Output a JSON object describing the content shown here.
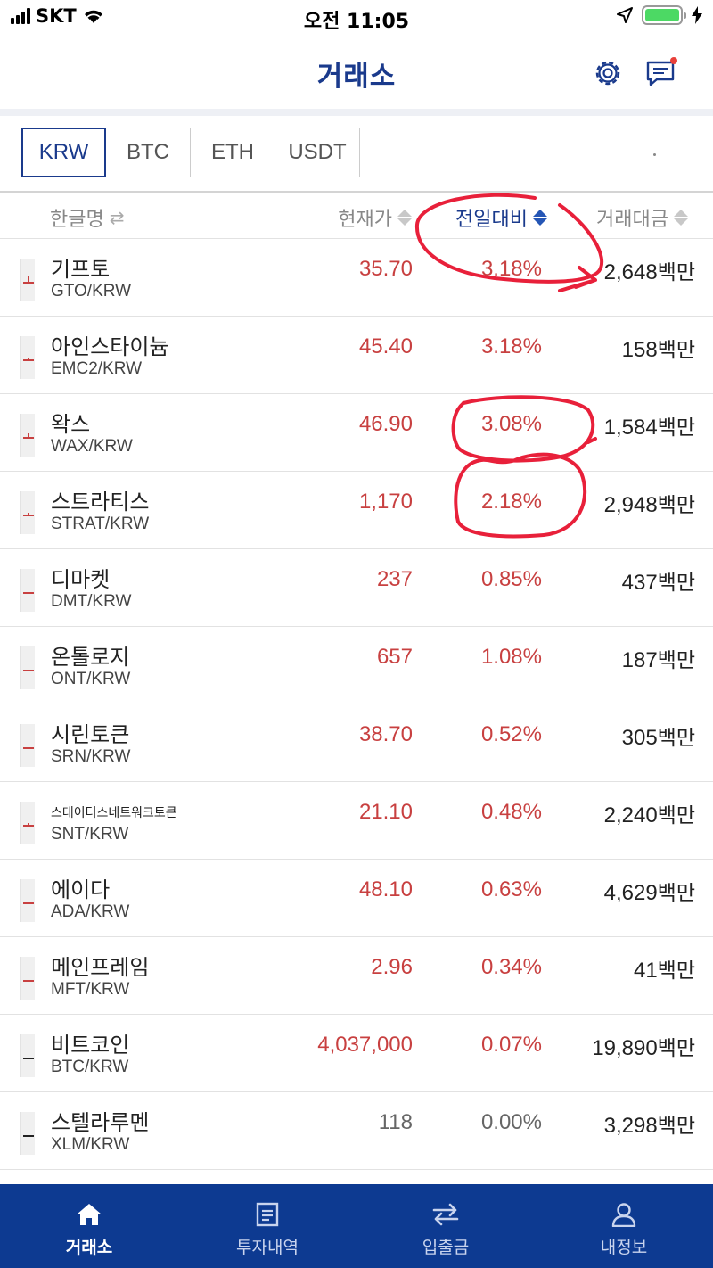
{
  "status_bar": {
    "carrier": "SKT",
    "time": "오전 11:05"
  },
  "header": {
    "title": "거래소"
  },
  "market_tabs": [
    "KRW",
    "BTC",
    "ETH",
    "USDT"
  ],
  "columns": {
    "name": "한글명",
    "price": "현재가",
    "change": "전일대비",
    "volume": "거래대금"
  },
  "coins": [
    {
      "name": "기프토",
      "pair": "GTO/KRW",
      "price": "35.70",
      "change": "3.18%",
      "volume_num": "2,648",
      "volume_unit": "백만"
    },
    {
      "name": "아인스타이늄",
      "pair": "EMC2/KRW",
      "price": "45.40",
      "change": "3.18%",
      "volume_num": "158",
      "volume_unit": "백만"
    },
    {
      "name": "왁스",
      "pair": "WAX/KRW",
      "price": "46.90",
      "change": "3.08%",
      "volume_num": "1,584",
      "volume_unit": "백만"
    },
    {
      "name": "스트라티스",
      "pair": "STRAT/KRW",
      "price": "1,170",
      "change": "2.18%",
      "volume_num": "2,948",
      "volume_unit": "백만"
    },
    {
      "name": "디마켓",
      "pair": "DMT/KRW",
      "price": "237",
      "change": "0.85%",
      "volume_num": "437",
      "volume_unit": "백만"
    },
    {
      "name": "온톨로지",
      "pair": "ONT/KRW",
      "price": "657",
      "change": "1.08%",
      "volume_num": "187",
      "volume_unit": "백만"
    },
    {
      "name": "시린토큰",
      "pair": "SRN/KRW",
      "price": "38.70",
      "change": "0.52%",
      "volume_num": "305",
      "volume_unit": "백만"
    },
    {
      "name": "스테이터스네트워크토큰",
      "pair": "SNT/KRW",
      "price": "21.10",
      "change": "0.48%",
      "volume_num": "2,240",
      "volume_unit": "백만"
    },
    {
      "name": "에이다",
      "pair": "ADA/KRW",
      "price": "48.10",
      "change": "0.63%",
      "volume_num": "4,629",
      "volume_unit": "백만"
    },
    {
      "name": "메인프레임",
      "pair": "MFT/KRW",
      "price": "2.96",
      "change": "0.34%",
      "volume_num": "41",
      "volume_unit": "백만"
    },
    {
      "name": "비트코인",
      "pair": "BTC/KRW",
      "price": "4,037,000",
      "change": "0.07%",
      "volume_num": "19,890",
      "volume_unit": "백만"
    },
    {
      "name": "스텔라루멘",
      "pair": "XLM/KRW",
      "price": "118",
      "change": "0.00%",
      "volume_num": "3,298",
      "volume_unit": "백만"
    }
  ],
  "bottom_nav": [
    "거래소",
    "투자내역",
    "입출금",
    "내정보"
  ],
  "colors": {
    "brand": "#0d3a91",
    "rise": "#c84040",
    "neutral": "#666666",
    "annotation": "#e8203a"
  },
  "icons": [
    "signal-icon",
    "wifi-icon",
    "location-arrow-icon",
    "battery-icon",
    "charging-icon",
    "settings-gear-icon",
    "chat-bubble-icon",
    "notification-dot",
    "sort-arrows-icon",
    "swap-icon",
    "home-icon",
    "document-icon",
    "transfer-arrows-icon",
    "person-icon"
  ]
}
